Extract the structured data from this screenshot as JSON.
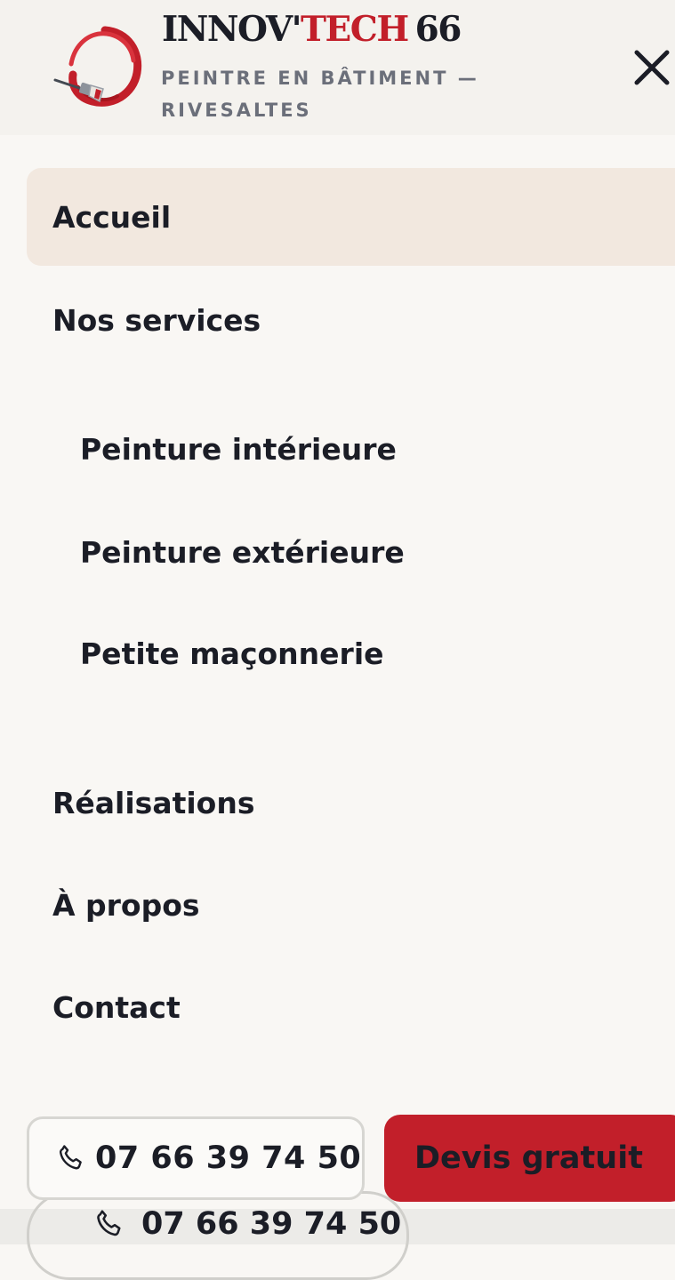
{
  "header": {
    "brand_part_1": "INNOV'",
    "brand_part_2": "TECH",
    "brand_part_3": "66",
    "tagline": "PEINTRE EN BÂTIMENT — RIVESALTES",
    "close_icon": "close-icon",
    "logo_icon": "paint-brush-swirl-logo"
  },
  "nav": {
    "items": [
      {
        "label": "Accueil",
        "active": true
      },
      {
        "label": "Nos services"
      },
      {
        "label": "Peinture intérieure",
        "sub": true
      },
      {
        "label": "Peinture extérieure",
        "sub": true
      },
      {
        "label": "Petite maçonnerie",
        "sub": true
      },
      {
        "label": "Réalisations"
      },
      {
        "label": "À propos"
      },
      {
        "label": "Contact"
      }
    ]
  },
  "actions": {
    "phone_label": "07 66 39 74 50",
    "phone_icon": "phone-icon",
    "quote_label": "Devis gratuit"
  },
  "background_page": {
    "phone_label": "07 66 39 74 50"
  },
  "colors": {
    "accent": "#c21f2a",
    "text": "#1b1d26",
    "active_bg": "#f2e8df",
    "page_bg": "#f9f7f4",
    "muted": "#6b6f7a"
  }
}
